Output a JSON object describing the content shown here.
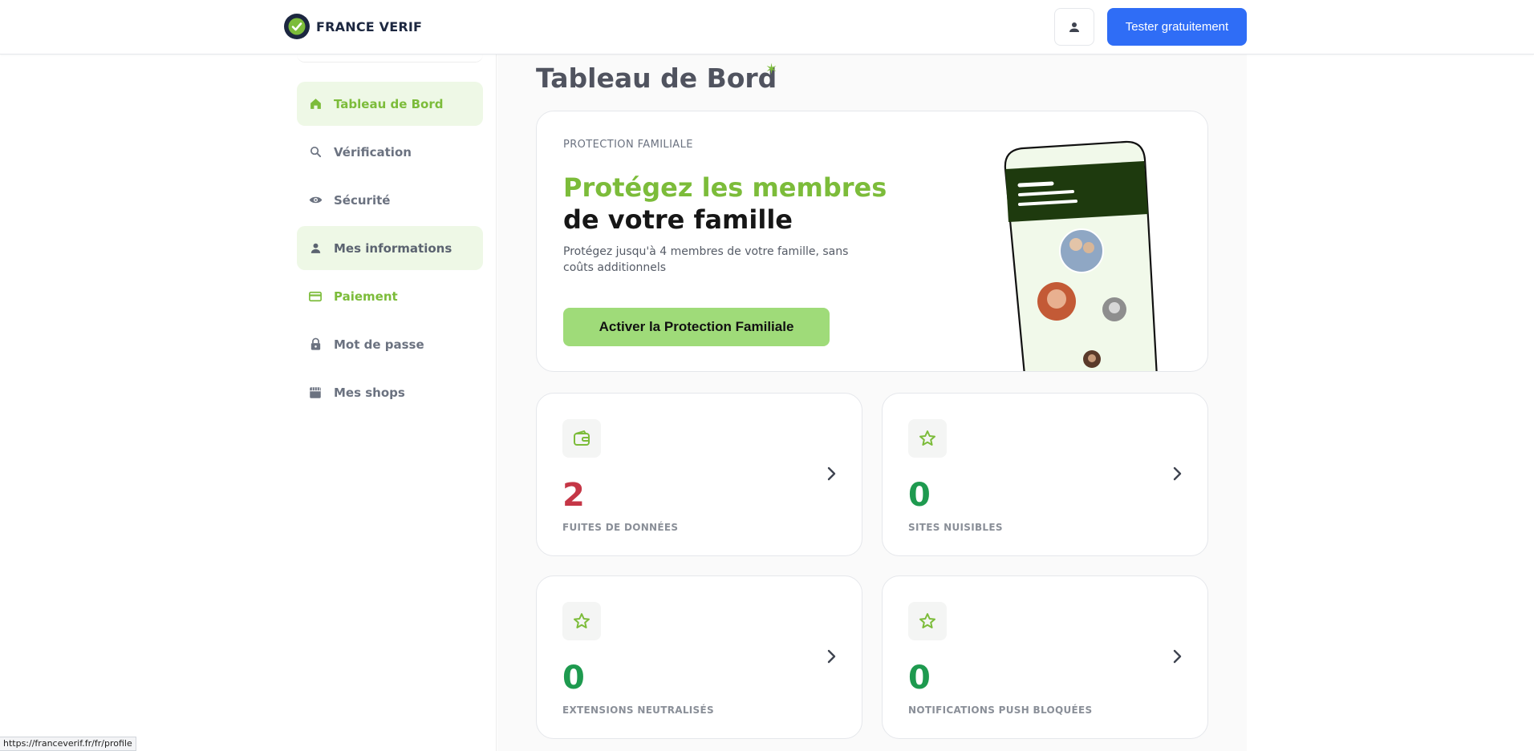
{
  "header": {
    "brand": "FRANCE VERIF",
    "cta_label": "Tester gratuitement"
  },
  "sidebar": {
    "items": [
      {
        "label": "Tableau de Bord",
        "icon": "home-icon"
      },
      {
        "label": "Vérification",
        "icon": "search-icon"
      },
      {
        "label": "Sécurité",
        "icon": "eye-icon"
      },
      {
        "label": "Mes informations",
        "icon": "user-icon"
      },
      {
        "label": "Paiement",
        "icon": "credit-card-icon"
      },
      {
        "label": "Mot de passe",
        "icon": "lock-icon"
      },
      {
        "label": "Mes shops",
        "icon": "store-icon"
      }
    ]
  },
  "main": {
    "title": "Tableau de Bord",
    "promo": {
      "eyebrow": "PROTECTION FAMILIALE",
      "headline_green": "Protégez les membres",
      "headline_dark": "de votre famille",
      "description": "Protégez jusqu'à 4 membres de votre famille, sans coûts additionnels",
      "button_label": "Activer la Protection Familiale"
    },
    "stats": [
      {
        "value": "2",
        "label": "FUITES DE DONNÉES",
        "icon": "wallet-icon",
        "color": "#c53646"
      },
      {
        "value": "0",
        "label": "SITES NUISIBLES",
        "icon": "star-icon",
        "color": "#1e9a4f"
      },
      {
        "value": "0",
        "label": "EXTENSIONS NEUTRALISÉS",
        "icon": "star-icon",
        "color": "#1e9a4f"
      },
      {
        "value": "0",
        "label": "NOTIFICATIONS PUSH BLOQUÉES",
        "icon": "star-icon",
        "color": "#1e9a4f"
      }
    ]
  },
  "status_bar": {
    "url": "https://franceverif.fr/fr/profile"
  },
  "colors": {
    "accent_green": "#7cbc3a",
    "primary_blue": "#2f6df6",
    "danger": "#c53646",
    "success": "#1e9a4f"
  }
}
